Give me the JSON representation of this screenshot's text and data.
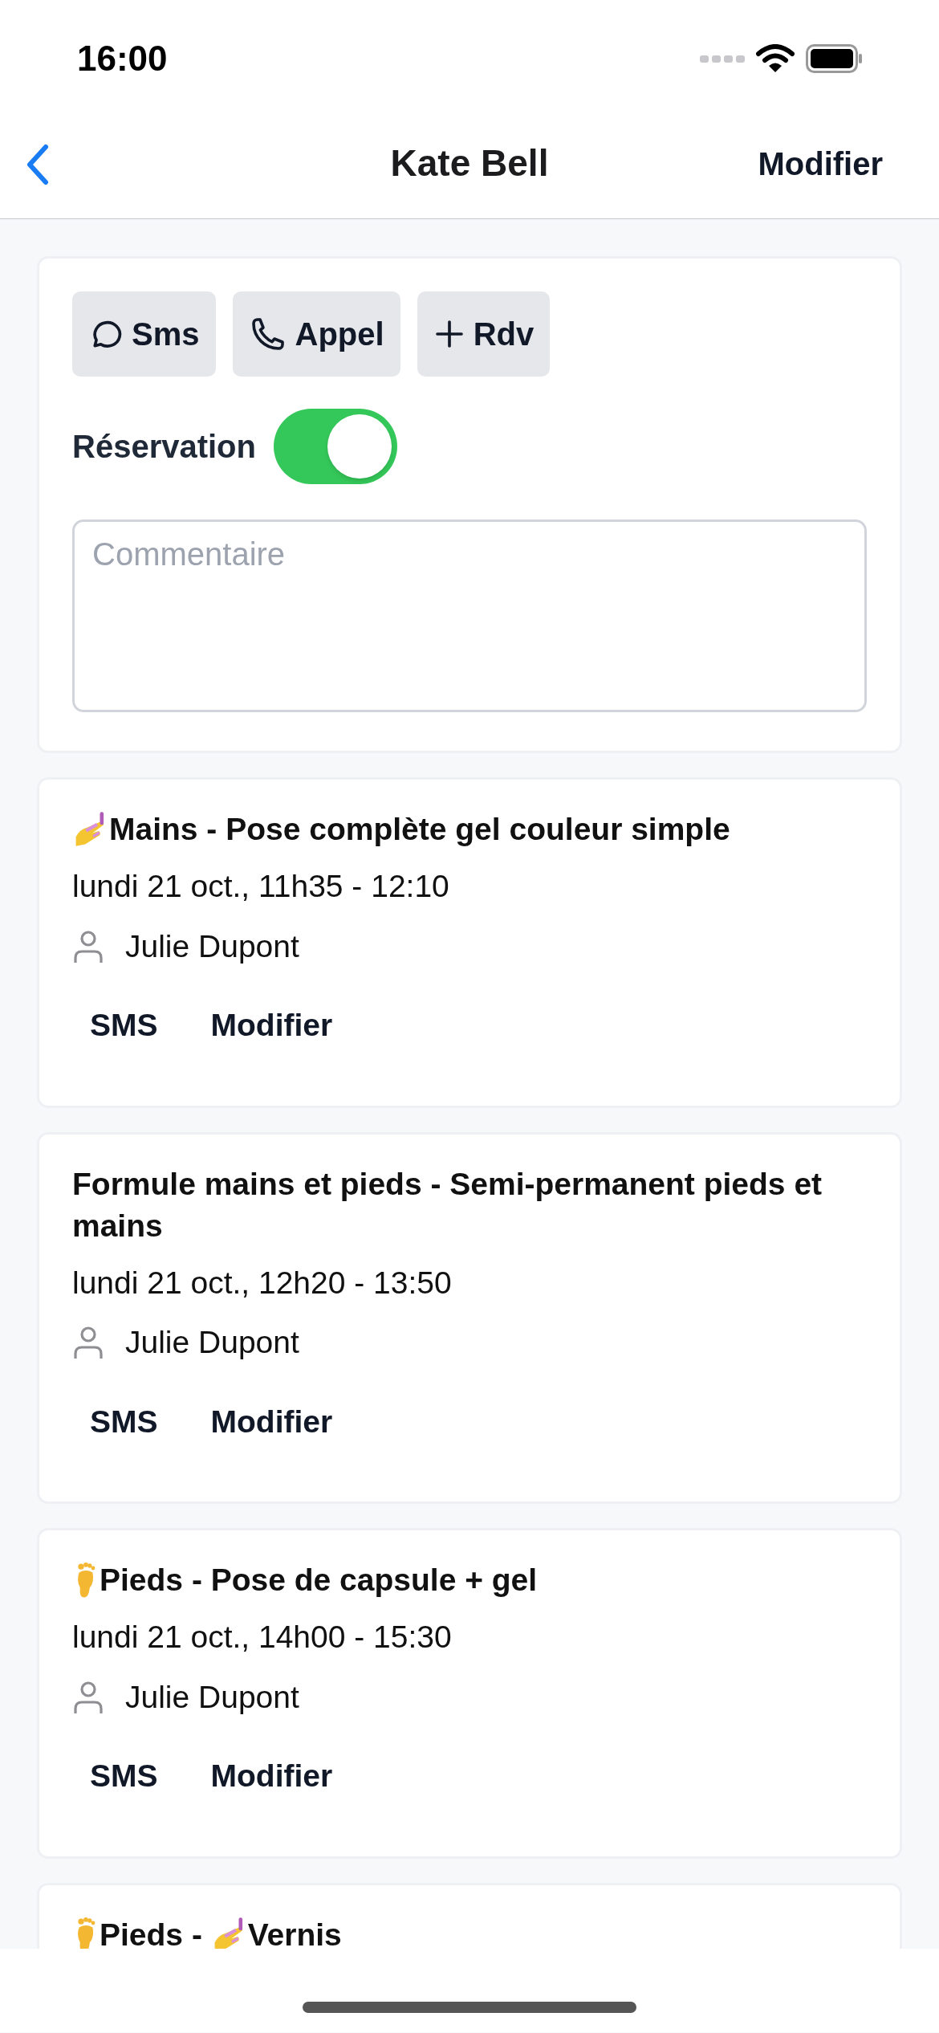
{
  "status_bar": {
    "time": "16:00"
  },
  "nav": {
    "title": "Kate Bell",
    "action": "Modifier"
  },
  "actions": [
    {
      "kind": "chat",
      "label": "Sms"
    },
    {
      "kind": "phone",
      "label": "Appel"
    },
    {
      "kind": "plus",
      "label": "Rdv"
    }
  ],
  "reservation": {
    "label": "Réservation",
    "on": true
  },
  "comment": {
    "placeholder": "Commentaire"
  },
  "appointments": [
    {
      "title": [
        {
          "kind": "nails"
        },
        {
          "kind": "text",
          "text": "Mains - Pose complète gel couleur simple"
        }
      ],
      "time": "lundi 21 oct., 11h35 - 12:10",
      "staff": "Julie Dupont",
      "buttons": [
        "SMS",
        "Modifier"
      ]
    },
    {
      "title": [
        {
          "kind": "text",
          "text": "Formule mains et pieds - Semi-permanent pieds et mains"
        }
      ],
      "time": "lundi 21 oct., 12h20 - 13:50",
      "staff": "Julie Dupont",
      "buttons": [
        "SMS",
        "Modifier"
      ]
    },
    {
      "title": [
        {
          "kind": "foot"
        },
        {
          "kind": "text",
          "text": "Pieds - Pose de capsule + gel"
        }
      ],
      "time": "lundi 21 oct., 14h00 - 15:30",
      "staff": "Julie Dupont",
      "buttons": [
        "SMS",
        "Modifier"
      ]
    },
    {
      "title": [
        {
          "kind": "foot"
        },
        {
          "kind": "text",
          "text": "Pieds - "
        },
        {
          "kind": "nails"
        },
        {
          "kind": "text",
          "text": "Vernis"
        }
      ]
    }
  ]
}
